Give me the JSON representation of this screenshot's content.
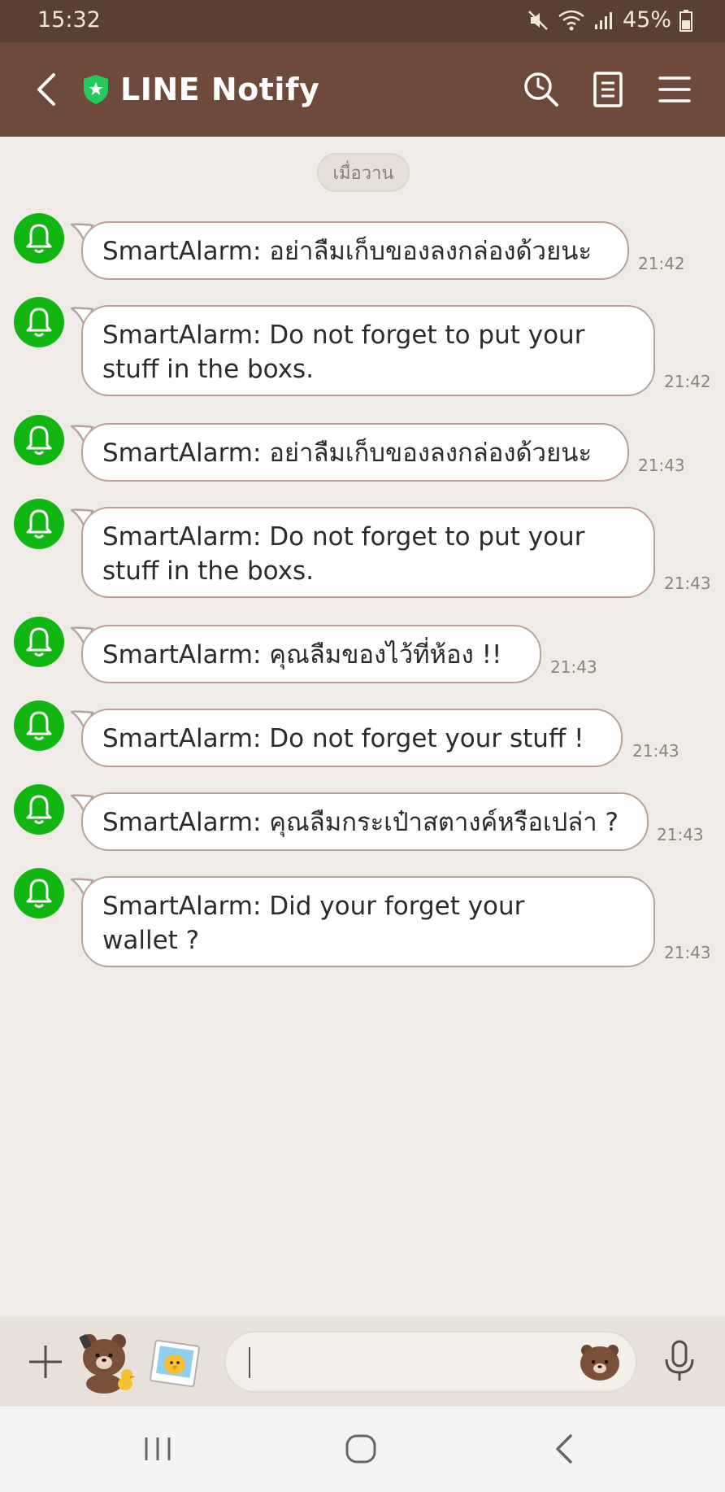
{
  "status_bar": {
    "time": "15:32",
    "battery": "45%"
  },
  "header": {
    "title": "LINE Notify"
  },
  "date_chip": "เมื่อวาน",
  "messages": [
    {
      "text": "SmartAlarm: อย่าลืมเก็บของลงกล่องด้วยนะ",
      "time": "21:42"
    },
    {
      "text": "SmartAlarm: Do not forget to put your stuff in the boxs.",
      "time": "21:42"
    },
    {
      "text": "SmartAlarm: อย่าลืมเก็บของลงกล่องด้วยนะ",
      "time": "21:43"
    },
    {
      "text": "SmartAlarm: Do not forget to put your stuff in the boxs.",
      "time": "21:43"
    },
    {
      "text": "SmartAlarm: คุณลืมของไว้ที่ห้อง !!",
      "time": "21:43"
    },
    {
      "text": "SmartAlarm: Do not forget your stuff !",
      "time": "21:43"
    },
    {
      "text": "SmartAlarm: คุณลืมกระเป๋าสตางค์หรือเปล่า ?",
      "time": "21:43"
    },
    {
      "text": "SmartAlarm: Did your forget your wallet ?",
      "time": "21:43"
    }
  ],
  "input": {
    "value": ""
  },
  "colors": {
    "accent_green": "#12b612",
    "header_brown": "#6d4a3c",
    "status_brown": "#5a4032"
  },
  "icons": {
    "header": [
      "back-icon",
      "shield-star-icon",
      "search-icon",
      "notes-icon",
      "menu-icon"
    ],
    "input": [
      "plus-icon",
      "brown-bear-sticker-icon",
      "sally-sticker-icon",
      "bear-emoji-icon",
      "mic-icon"
    ],
    "nav": [
      "recent-apps-icon",
      "home-icon",
      "nav-back-icon"
    ]
  }
}
